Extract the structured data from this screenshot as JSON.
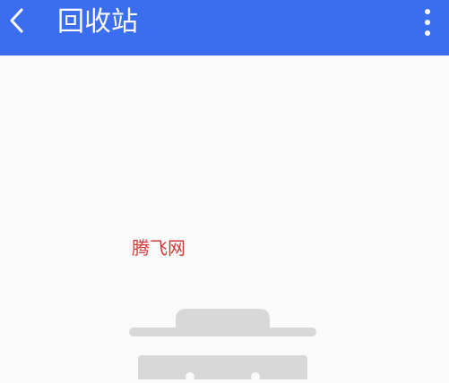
{
  "appbar": {
    "title": "回收站",
    "back_icon": "chevron-left-icon",
    "more_icon": "more-vertical-icon",
    "color": "#3b6def"
  },
  "main": {
    "watermark_text": "腾飞网",
    "empty_state_icon": "trash-bin-icon"
  }
}
